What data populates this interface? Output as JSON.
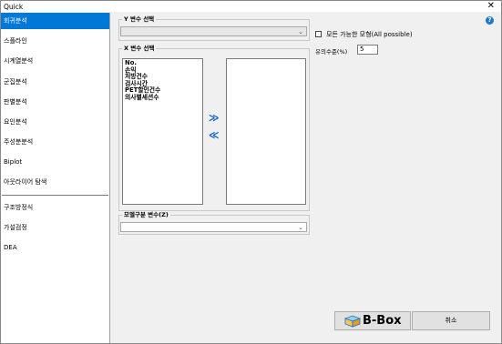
{
  "window": {
    "title": "Quick",
    "close_label": "✕"
  },
  "sidebar": {
    "items": [
      {
        "label": "회귀분석",
        "selected": true
      },
      {
        "label": "스플라인"
      },
      {
        "label": "시계열분석"
      },
      {
        "label": "군집분석"
      },
      {
        "label": "판별분석"
      },
      {
        "label": "요인분석"
      },
      {
        "label": "주성분분석"
      },
      {
        "label": "Biplot"
      },
      {
        "label": "아웃라이어 탐색"
      },
      {
        "label": "구조방정식"
      },
      {
        "label": "가설검정"
      },
      {
        "label": "DEA"
      }
    ]
  },
  "y_var": {
    "label": "Y 변수 선택",
    "value": ""
  },
  "x_var": {
    "label": "X 변수 선택",
    "available": [
      "No.",
      "손익",
      "처방건수",
      "검사시간",
      "PET할인건수",
      "의사별세션수"
    ],
    "selected": []
  },
  "move": {
    "add": "≫",
    "remove": "≪"
  },
  "model_group": {
    "label": "모델구분 변수(Z)",
    "value": ""
  },
  "options": {
    "all_possible_label": "모든 가능한 모형(All possible)",
    "all_possible_checked": false,
    "sig_level_label": "유의수준(%)",
    "sig_level_value": "5"
  },
  "buttons": {
    "bbox_label": "B-Box",
    "cancel_label": "취소"
  },
  "help_label": "?",
  "colors": {
    "accent": "#0078d7",
    "arrow": "#0b63c5"
  }
}
